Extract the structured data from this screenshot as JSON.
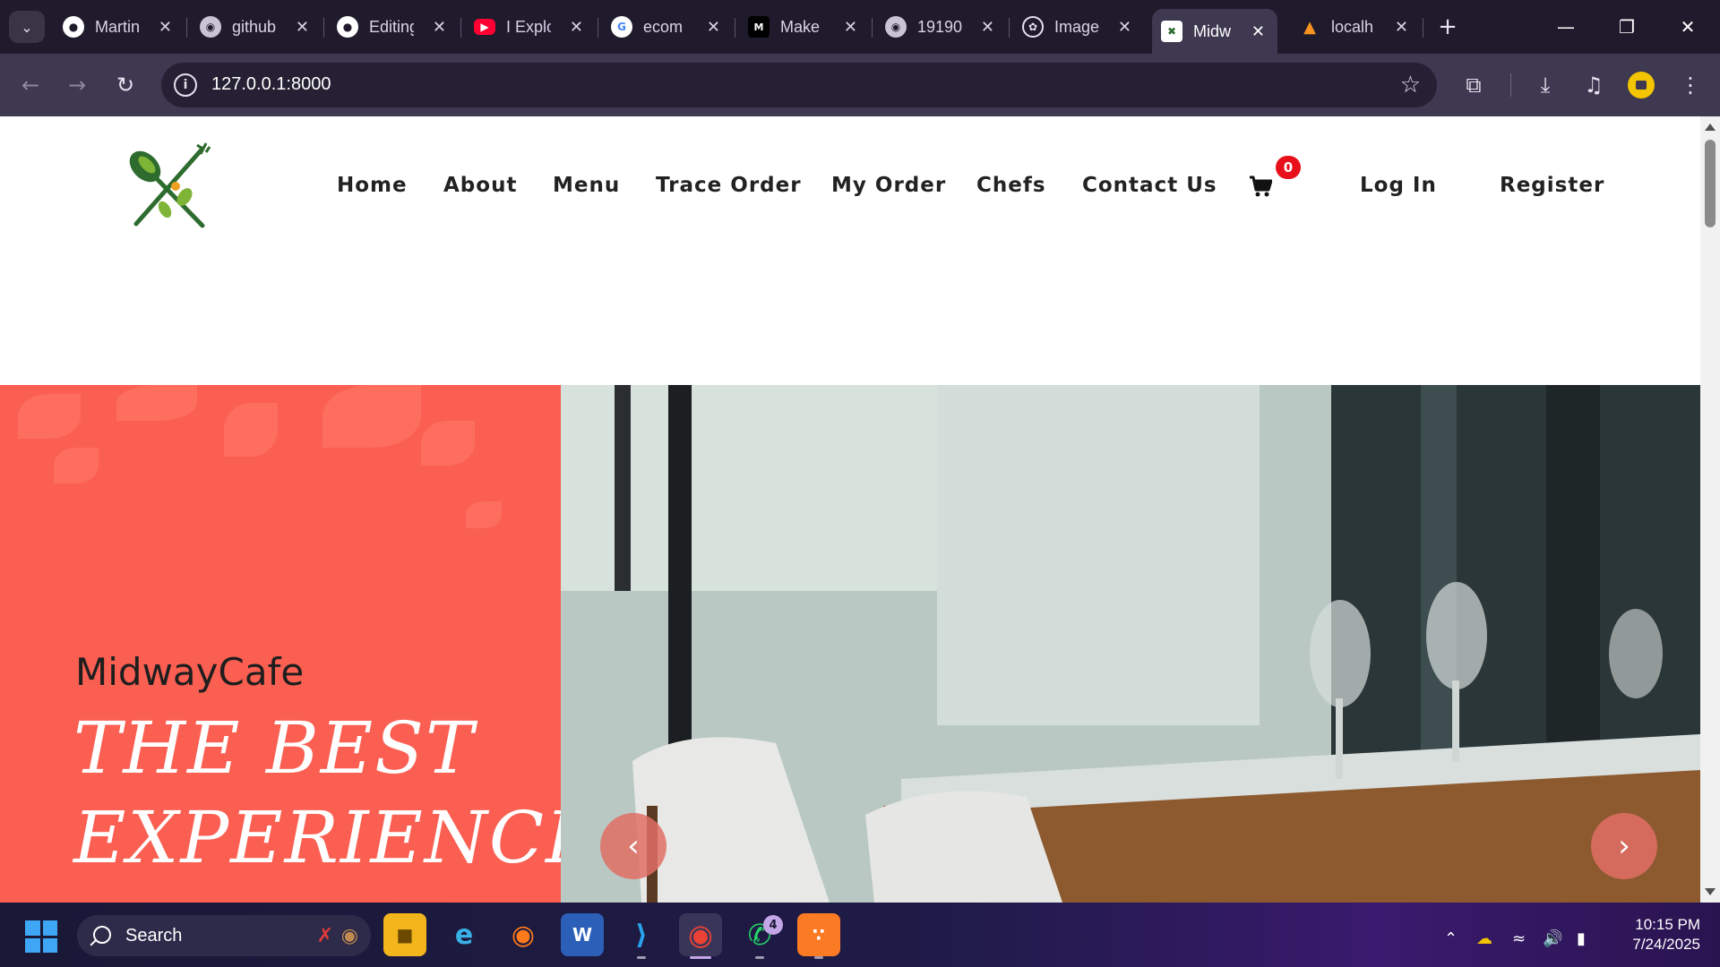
{
  "browser": {
    "tabs": [
      {
        "title": "Martin",
        "favicon": "github-icon",
        "active": false
      },
      {
        "title": "github",
        "favicon": "globe-icon",
        "active": false
      },
      {
        "title": "Editing",
        "favicon": "github-icon",
        "active": false
      },
      {
        "title": "I Explo",
        "favicon": "youtube-icon",
        "active": false
      },
      {
        "title": "ecom",
        "favicon": "google-icon",
        "active": false
      },
      {
        "title": "Make",
        "favicon": "make-icon",
        "active": false
      },
      {
        "title": "19190",
        "favicon": "globe-icon",
        "active": false
      },
      {
        "title": "Image",
        "favicon": "chatgpt-icon",
        "active": false
      },
      {
        "title": "Midw",
        "favicon": "midwaycafe-icon",
        "active": true
      },
      {
        "title": "localh",
        "favicon": "xampp-icon",
        "active": false
      }
    ],
    "url": "127.0.0.1:8000",
    "colors": {
      "tabstrip": "#201b2c",
      "toolbar": "#3e3850"
    }
  },
  "site": {
    "nav": {
      "home": "Home",
      "about": "About",
      "menu": "Menu",
      "trace_order": "Trace Order",
      "my_order": "My Order",
      "chefs": "Chefs",
      "contact_us": "Contact Us",
      "cart_count": "0",
      "login": "Log In",
      "register": "Register"
    },
    "hero": {
      "brand": "MidwayCafe",
      "title": "THE BEST EXPERIENCE",
      "accent_color": "#fa5f52"
    }
  },
  "taskbar": {
    "search_label": "Search",
    "whatsapp_badge": "4",
    "time": "10:15 PM",
    "date": "7/24/2025"
  }
}
